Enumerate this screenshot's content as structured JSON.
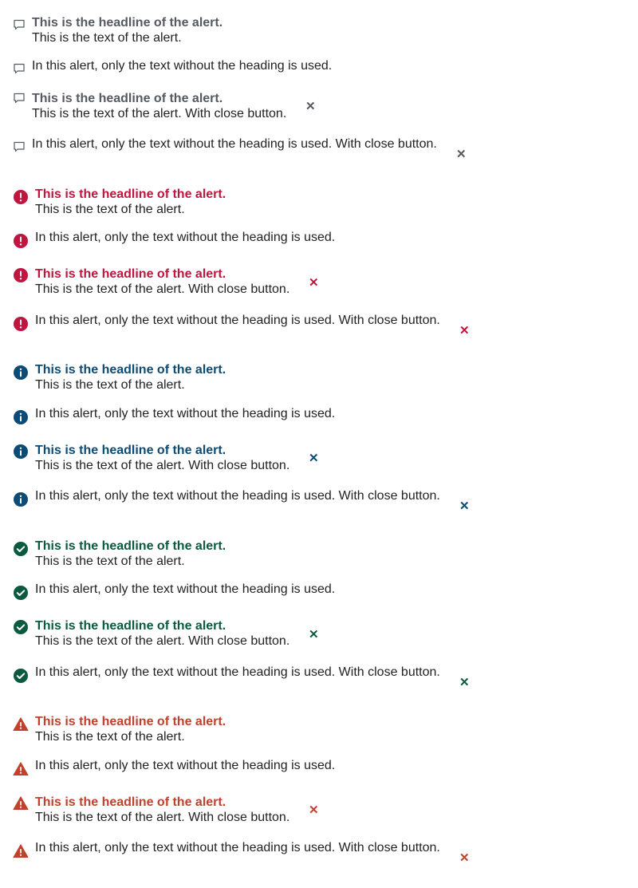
{
  "colors": {
    "neutral": "#555a60",
    "error": "#c0153f",
    "info": "#0b4b75",
    "success": "#0a5a40",
    "warning": "#c2412d"
  },
  "icons": {
    "neutral": "speech-bubble-icon",
    "error": "exclamation-circle-icon",
    "info": "info-circle-icon",
    "success": "check-circle-icon",
    "warning": "warning-triangle-icon",
    "close": "close-icon"
  },
  "close_glyph": "✕",
  "groups": {
    "neutral": {
      "a1": {
        "heading": "This is the headline of the alert.",
        "text": "This is the text of the alert."
      },
      "a2": {
        "text": "In this alert, only the text without the heading is used."
      },
      "a3": {
        "heading": "This is the headline of the alert.",
        "text": "This is the text of the alert. With close button."
      },
      "a4": {
        "text": "In this alert, only the text without the heading is used. With close button."
      }
    },
    "error": {
      "a1": {
        "heading": "This is the headline of the alert.",
        "text": "This is the text of the alert."
      },
      "a2": {
        "text": "In this alert, only the text without the heading is used."
      },
      "a3": {
        "heading": "This is the headline of the alert.",
        "text": "This is the text of the alert. With close button."
      },
      "a4": {
        "text": "In this alert, only the text without the heading is used. With close button."
      }
    },
    "info": {
      "a1": {
        "heading": "This is the headline of the alert.",
        "text": "This is the text of the alert."
      },
      "a2": {
        "text": "In this alert, only the text without the heading is used."
      },
      "a3": {
        "heading": "This is the headline of the alert.",
        "text": "This is the text of the alert. With close button."
      },
      "a4": {
        "text": "In this alert, only the text without the heading is used. With close button."
      }
    },
    "success": {
      "a1": {
        "heading": "This is the headline of the alert.",
        "text": "This is the text of the alert."
      },
      "a2": {
        "text": "In this alert, only the text without the heading is used."
      },
      "a3": {
        "heading": "This is the headline of the alert.",
        "text": "This is the text of the alert. With close button."
      },
      "a4": {
        "text": "In this alert, only the text without the heading is used. With close button."
      }
    },
    "warning": {
      "a1": {
        "heading": "This is the headline of the alert.",
        "text": "This is the text of the alert."
      },
      "a2": {
        "text": "In this alert, only the text without the heading is used."
      },
      "a3": {
        "heading": "This is the headline of the alert.",
        "text": "This is the text of the alert. With close button."
      },
      "a4": {
        "text": "In this alert, only the text without the heading is used. With close button."
      }
    }
  }
}
